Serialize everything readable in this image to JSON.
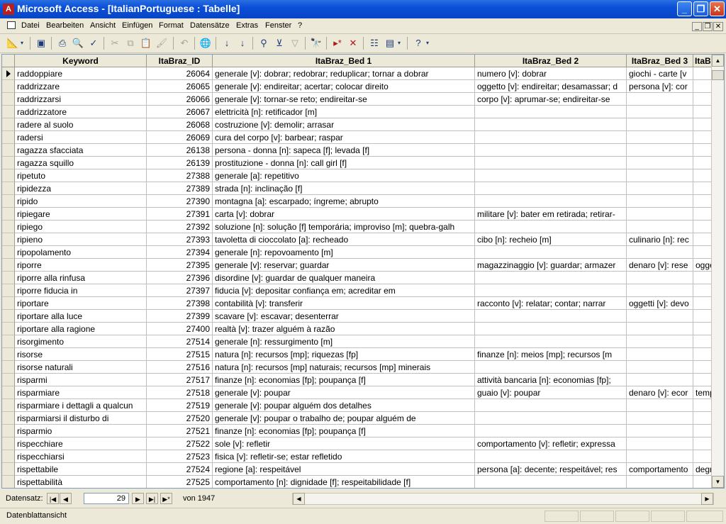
{
  "window": {
    "title": "Microsoft Access - [ItalianPortuguese : Tabelle]",
    "app_icon": "access-key-icon"
  },
  "menu": [
    "Datei",
    "Bearbeiten",
    "Ansicht",
    "Einfügen",
    "Format",
    "Datensätze",
    "Extras",
    "Fenster",
    "?"
  ],
  "toolbar": [
    "view-icon",
    "save-icon",
    "print-icon",
    "print-preview-icon",
    "spelling-icon",
    "cut-icon",
    "copy-icon",
    "paste-icon",
    "format-painter-icon",
    "undo-icon",
    "hyperlink-icon",
    "sort-ascending-icon",
    "sort-descending-icon",
    "filter-by-selection-icon",
    "filter-by-form-icon",
    "apply-filter-icon",
    "find-icon",
    "new-record-icon",
    "delete-record-icon",
    "properties-icon",
    "database-window-icon",
    "help-icon"
  ],
  "table": {
    "columns": [
      "Keyword",
      "ItaBraz_ID",
      "ItaBraz_Bed 1",
      "ItaBraz_Bed 2",
      "ItaBraz_Bed 3",
      "ItaB"
    ],
    "rows": [
      [
        "raddoppiare",
        "26064",
        "generale [v]: dobrar; redobrar; reduplicar; tornar a dobrar",
        "numero [v]: dobrar",
        "giochi - carte [v",
        ""
      ],
      [
        "raddrizzare",
        "26065",
        "generale [v]: endireitar; acertar; colocar direito",
        "oggetto [v]: endireitar; desamassar; d",
        "persona [v]: cor",
        ""
      ],
      [
        "raddrizzarsi",
        "26066",
        "generale [v]: tornar-se reto; endireitar-se",
        "corpo [v]: aprumar-se; endireitar-se",
        "",
        ""
      ],
      [
        "raddrizzatore",
        "26067",
        "elettricità [n]: retificador [m]",
        "",
        "",
        ""
      ],
      [
        "radere al suolo",
        "26068",
        "costruzione [v]: demolir; arrasar",
        "",
        "",
        ""
      ],
      [
        "radersi",
        "26069",
        "cura del corpo [v]: barbear; raspar",
        "",
        "",
        ""
      ],
      [
        "ragazza sfacciata",
        "26138",
        "persona - donna [n]: sapeca [f]; levada [f]",
        "",
        "",
        ""
      ],
      [
        "ragazza squillo",
        "26139",
        "prostituzione - donna [n]: call girl [f]",
        "",
        "",
        ""
      ],
      [
        "ripetuto",
        "27388",
        "generale [a]: repetitivo",
        "",
        "",
        ""
      ],
      [
        "ripidezza",
        "27389",
        "strada [n]: inclinação [f]",
        "",
        "",
        ""
      ],
      [
        "ripido",
        "27390",
        "montagna [a]: escarpado; íngreme; abrupto",
        "",
        "",
        ""
      ],
      [
        "ripiegare",
        "27391",
        "carta [v]: dobrar",
        "militare [v]: bater em retirada; retirar-",
        "",
        ""
      ],
      [
        "ripiego",
        "27392",
        "soluzione [n]: solução [f] temporária; improviso [m]; quebra-galh",
        "",
        "",
        ""
      ],
      [
        "ripieno",
        "27393",
        "tavoletta di cioccolato [a]: recheado",
        "cibo [n]: recheio [m]",
        "culinario [n]: rec",
        ""
      ],
      [
        "ripopolamento",
        "27394",
        "generale [n]: repovoamento [m]",
        "",
        "",
        ""
      ],
      [
        "riporre",
        "27395",
        "generale [v]: reservar; guardar",
        "magazzinaggio [v]: guardar; armazer",
        "denaro [v]: rese",
        "ogge"
      ],
      [
        "riporre alla rinfusa",
        "27396",
        "disordine [v]: guardar de qualquer maneira",
        "",
        "",
        ""
      ],
      [
        "riporre fiducia in",
        "27397",
        "fiducia [v]: depositar confiança em; acreditar em",
        "",
        "",
        ""
      ],
      [
        "riportare",
        "27398",
        "contabilità [v]: transferir",
        "racconto [v]: relatar; contar; narrar",
        "oggetti [v]: devo",
        ""
      ],
      [
        "riportare alla luce",
        "27399",
        "scavare [v]: escavar; desenterrar",
        "",
        "",
        ""
      ],
      [
        "riportare alla ragione",
        "27400",
        "realtà [v]: trazer alguém à razão",
        "",
        "",
        ""
      ],
      [
        "risorgimento",
        "27514",
        "generale [n]: ressurgimento [m]",
        "",
        "",
        ""
      ],
      [
        "risorse",
        "27515",
        "natura [n]: recursos [mp]; riquezas [fp]",
        "finanze [n]: meios [mp]; recursos [m",
        "",
        ""
      ],
      [
        "risorse naturali",
        "27516",
        "natura [n]: recursos [mp] naturais; recursos [mp] minerais",
        "",
        "",
        ""
      ],
      [
        "risparmi",
        "27517",
        "finanze [n]: economias [fp]; poupança [f]",
        "attività bancaria [n]: economias [fp];",
        "",
        ""
      ],
      [
        "risparmiare",
        "27518",
        "generale [v]: poupar",
        "guaio [v]: poupar",
        "denaro [v]: ecor",
        "temp"
      ],
      [
        "risparmiare i dettagli a qualcun",
        "27519",
        "generale [v]: poupar alguém dos detalhes",
        "",
        "",
        ""
      ],
      [
        "risparmiarsi il disturbo di",
        "27520",
        "generale [v]: poupar o trabalho de; poupar alguém de",
        "",
        "",
        ""
      ],
      [
        "risparmio",
        "27521",
        "finanze [n]: economias [fp]; poupança [f]",
        "",
        "",
        ""
      ],
      [
        "rispecchiare",
        "27522",
        "sole [v]: refletir",
        "comportamento [v]: refletir; expressa",
        "",
        ""
      ],
      [
        "rispecchiarsi",
        "27523",
        "fisica [v]: refletir-se; estar refletido",
        "",
        "",
        ""
      ],
      [
        "rispettabile",
        "27524",
        "regione [a]: respeitável",
        "persona [a]: decente; respeitável; res",
        "comportamento",
        "degr"
      ],
      [
        "rispettabilità",
        "27525",
        "comportamento [n]: dignidade [f]; respeitabilidade [f]",
        "",
        "",
        ""
      ]
    ]
  },
  "navigation": {
    "label": "Datensatz:",
    "current_record": "29",
    "of_text": "von 1947"
  },
  "status": {
    "text": "Datenblattansicht"
  }
}
